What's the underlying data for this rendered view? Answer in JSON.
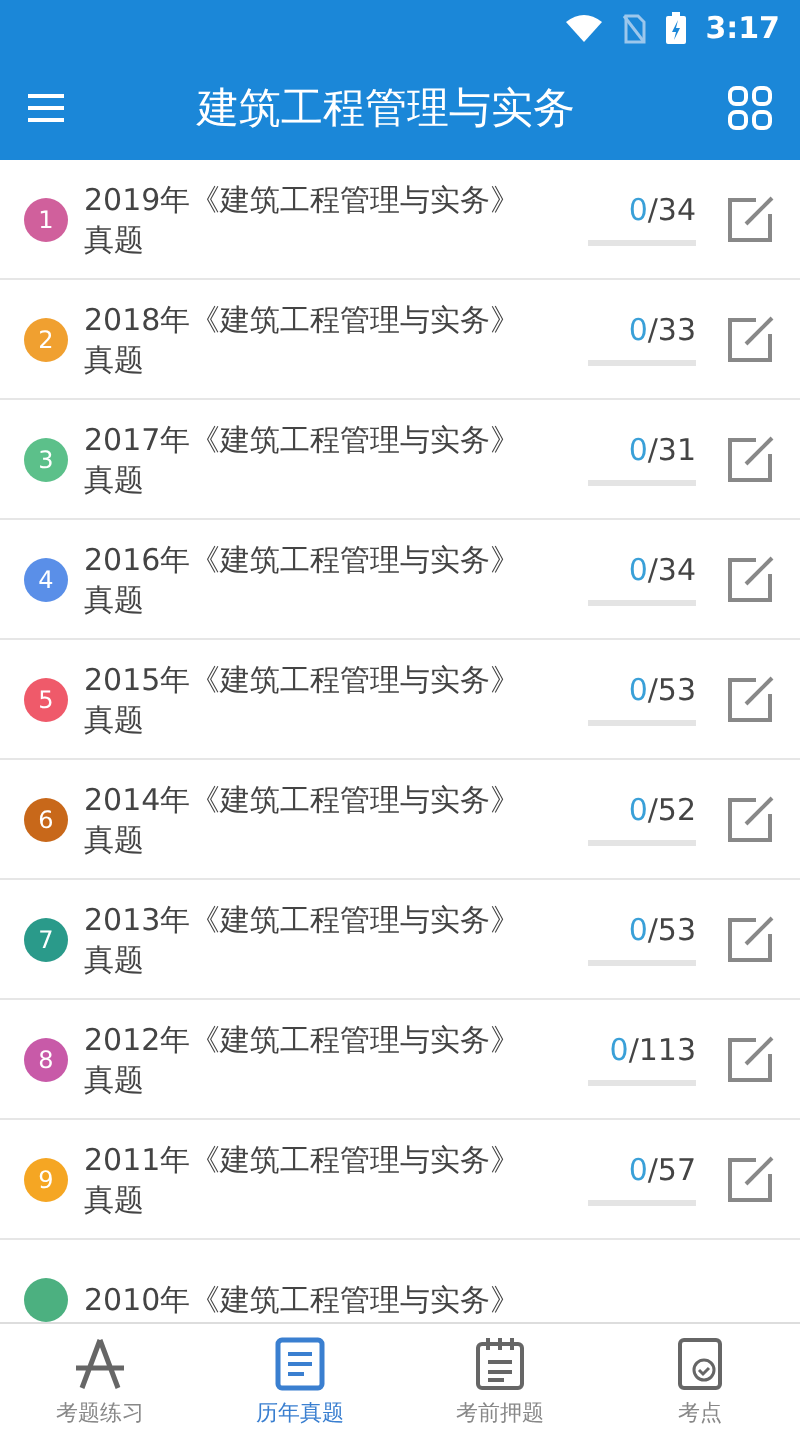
{
  "status_bar": {
    "time": "3:17"
  },
  "app_bar": {
    "title": "建筑工程管理与实务"
  },
  "papers": [
    {
      "number": "1",
      "color": "#d0609c",
      "title": "2019年《建筑工程管理与实务》",
      "subtitle": "真题",
      "done": "0",
      "total": "/34"
    },
    {
      "number": "2",
      "color": "#f0a030",
      "title": "2018年《建筑工程管理与实务》",
      "subtitle": "真题",
      "done": "0",
      "total": "/33"
    },
    {
      "number": "3",
      "color": "#5cc08a",
      "title": "2017年《建筑工程管理与实务》",
      "subtitle": "真题",
      "done": "0",
      "total": "/31"
    },
    {
      "number": "4",
      "color": "#5a8fe8",
      "title": "2016年《建筑工程管理与实务》",
      "subtitle": "真题",
      "done": "0",
      "total": "/34"
    },
    {
      "number": "5",
      "color": "#ef5a6a",
      "title": "2015年《建筑工程管理与实务》",
      "subtitle": "真题",
      "done": "0",
      "total": "/53"
    },
    {
      "number": "6",
      "color": "#c8681a",
      "title": "2014年《建筑工程管理与实务》",
      "subtitle": "真题",
      "done": "0",
      "total": "/52"
    },
    {
      "number": "7",
      "color": "#2a9a8a",
      "title": "2013年《建筑工程管理与实务》",
      "subtitle": "真题",
      "done": "0",
      "total": "/53"
    },
    {
      "number": "8",
      "color": "#c85aa8",
      "title": "2012年《建筑工程管理与实务》",
      "subtitle": "真题",
      "done": "0",
      "total": "/113"
    },
    {
      "number": "9",
      "color": "#f5a623",
      "title": "2011年《建筑工程管理与实务》",
      "subtitle": "真题",
      "done": "0",
      "total": "/57"
    },
    {
      "color": "#4cb080",
      "title": "2010年《建筑工程管理与实务》"
    }
  ],
  "bottom_nav": [
    {
      "kind": "practice",
      "label": "考题练习",
      "selected": false
    },
    {
      "kind": "papers",
      "label": "历年真题",
      "selected": true
    },
    {
      "kind": "predict",
      "label": "考前押题",
      "selected": false
    },
    {
      "kind": "points",
      "label": "考点",
      "selected": false
    }
  ]
}
